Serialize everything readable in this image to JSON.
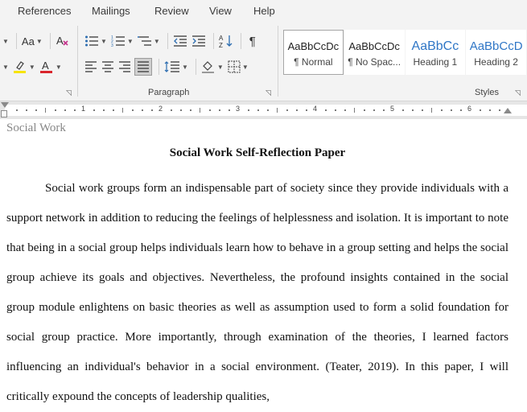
{
  "tabs": [
    "References",
    "Mailings",
    "Review",
    "View",
    "Help"
  ],
  "font_group": {
    "change_case": "Aa",
    "highlight_color": "#f7e400",
    "font_color": "#d9262c"
  },
  "paragraph_group": {
    "label": "Paragraph"
  },
  "styles_group": {
    "label": "Styles",
    "items": [
      {
        "sample": "AaBbCcDc",
        "name": "¶ Normal"
      },
      {
        "sample": "AaBbCcDc",
        "name": "¶ No Spac..."
      },
      {
        "sample": "AaBbCc",
        "name": "Heading 1"
      },
      {
        "sample": "AaBbCcD",
        "name": "Heading 2"
      }
    ]
  },
  "ruler": {
    "numbers": [
      "1",
      "2",
      "3",
      "4",
      "5",
      "6"
    ]
  },
  "document": {
    "running_head": "Social Work",
    "title": "Social Work Self-Reflection Paper",
    "paragraph": "Social work groups form an indispensable part of society since they provide individuals with a support network in addition to reducing the feelings of helplessness and isolation. It is important to note that being in a social group helps individuals learn how to behave in a group setting and helps the social group achieve its goals and objectives. Nevertheless, the profound insights contained in the social group module enlightens on basic theories as well as assumption used to form a solid foundation for social group practice. More importantly, through examination of the theories, I learned factors influencing an individual's behavior in a social environment. (Teater, 2019). In this paper, I will critically expound the concepts of leadership qualities,"
  }
}
